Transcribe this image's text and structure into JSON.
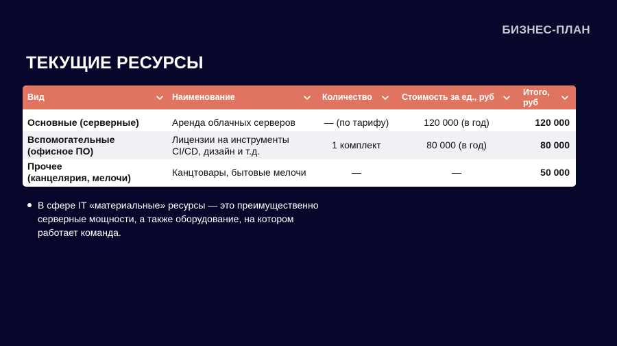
{
  "brand": "БИЗНЕС-ПЛАН",
  "title": "ТЕКУЩИЕ РЕСУРСЫ",
  "table": {
    "columns": [
      {
        "label": "Вид",
        "icon": "chevron-down-icon"
      },
      {
        "label": "Наименование",
        "icon": "chevron-down-icon"
      },
      {
        "label": "Количество",
        "icon": "chevron-down-icon"
      },
      {
        "label": "Стоимость за ед., руб",
        "icon": "chevron-down-icon"
      },
      {
        "label_line1": "Итого,",
        "label_line2": "руб",
        "icon": "chevron-down-icon"
      }
    ],
    "rows": [
      {
        "type_line1": "Основные (серверные)",
        "type_line2": "",
        "name_line1": "Аренда облачных серверов",
        "name_line2": "",
        "quantity": "— (по тарифу)",
        "unit_cost": "120 000 (в год)",
        "total": "120 000"
      },
      {
        "type_line1": "Вспомогательные",
        "type_line2": "(офисное ПО)",
        "name_line1": "Лицензии на инструменты",
        "name_line2": "CI/CD, дизайн и т.д.",
        "quantity": "1 комплект",
        "unit_cost": "80 000 (в год)",
        "total": "80 000"
      },
      {
        "type_line1": "Прочее",
        "type_line2": "(канцелярия, мелочи)",
        "name_line1": "Канцтовары, бытовые мелочи",
        "name_line2": "",
        "quantity": "—",
        "unit_cost": "—",
        "total": "50 000"
      }
    ]
  },
  "bullet": {
    "line1": "В сфере IT «материальные» ресурсы — это преимущественно",
    "line2": "серверные мощности, а также оборудование, на котором",
    "line3": "работает команда."
  },
  "colors": {
    "background": "#07072c",
    "header_accent": "#df7560",
    "row_alt": "#f0f1f4"
  }
}
